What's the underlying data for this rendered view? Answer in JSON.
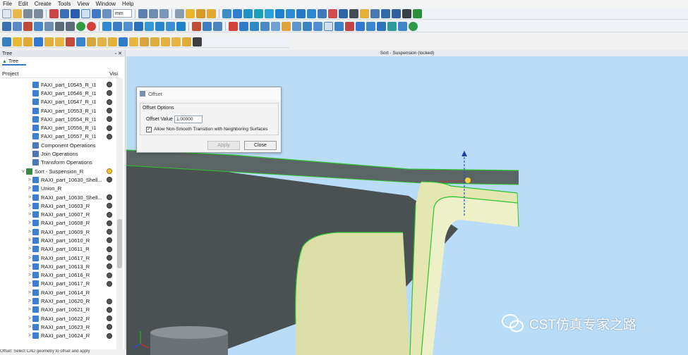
{
  "menu": [
    "File",
    "Edit",
    "Create",
    "Tools",
    "View",
    "Window",
    "Help"
  ],
  "toolbar": {
    "units_value": "mm"
  },
  "tree": {
    "panel_title": "Tree",
    "tab_label": "Tree",
    "col_project": "Project",
    "col_visible": "Visi",
    "items": [
      {
        "label": "FAXI_part_10545_R_I1",
        "indent": 1,
        "chev": "",
        "icon": "part-icon",
        "vis": true
      },
      {
        "label": "FAXI_part_10546_R_I1",
        "indent": 1,
        "chev": "",
        "icon": "part-icon",
        "vis": true
      },
      {
        "label": "FAXI_part_10547_R_I1",
        "indent": 1,
        "chev": "",
        "icon": "part-icon",
        "vis": true
      },
      {
        "label": "FAXI_part_10553_R_I1",
        "indent": 1,
        "chev": "",
        "icon": "part-icon",
        "vis": true
      },
      {
        "label": "FAXI_part_10554_R_I1",
        "indent": 1,
        "chev": "",
        "icon": "part-icon",
        "vis": true
      },
      {
        "label": "FAXI_part_10556_R_I1",
        "indent": 1,
        "chev": "",
        "icon": "part-icon",
        "vis": true
      },
      {
        "label": "FAXI_part_10557_R_I1",
        "indent": 1,
        "chev": "",
        "icon": "part-icon",
        "vis": true
      },
      {
        "label": "Component Operations",
        "indent": 1,
        "chev": "",
        "icon": "operations-icon",
        "vis": false
      },
      {
        "label": "Join Operations",
        "indent": 1,
        "chev": "",
        "icon": "operations-icon",
        "vis": false
      },
      {
        "label": "Transform Operations",
        "indent": 1,
        "chev": "",
        "icon": "operations-icon",
        "vis": false
      },
      {
        "label": "Sort - Suspension_R",
        "indent": 0,
        "chev": "v",
        "icon": "sort-icon",
        "vis": false
      },
      {
        "label": "RAXI_part_10630_Shell...",
        "indent": 1,
        "chev": ">",
        "icon": "part-icon",
        "vis": true
      },
      {
        "label": "Union_R",
        "indent": 1,
        "chev": ">",
        "icon": "part-icon",
        "vis": false
      },
      {
        "label": "RAXI_part_10630_Shell...",
        "indent": 1,
        "chev": ">",
        "icon": "part-icon",
        "vis": true
      },
      {
        "label": "RAXI_part_10603_R",
        "indent": 1,
        "chev": ">",
        "icon": "part-icon",
        "vis": true
      },
      {
        "label": "RAXI_part_10607_R",
        "indent": 1,
        "chev": ">",
        "icon": "part-icon",
        "vis": true
      },
      {
        "label": "RAXI_part_10608_R",
        "indent": 1,
        "chev": ">",
        "icon": "part-icon",
        "vis": true
      },
      {
        "label": "RAXI_part_10609_R",
        "indent": 1,
        "chev": ">",
        "icon": "part-icon",
        "vis": true
      },
      {
        "label": "RAXI_part_10610_R",
        "indent": 1,
        "chev": ">",
        "icon": "part-icon",
        "vis": true
      },
      {
        "label": "RAXI_part_10611_R",
        "indent": 1,
        "chev": ">",
        "icon": "part-icon",
        "vis": true
      },
      {
        "label": "RAXI_part_10617_R",
        "indent": 1,
        "chev": ">",
        "icon": "part-icon",
        "vis": true
      },
      {
        "label": "RAXI_part_10613_R",
        "indent": 1,
        "chev": ">",
        "icon": "part-icon",
        "vis": true
      },
      {
        "label": "RAXI_part_10616_R",
        "indent": 1,
        "chev": ">",
        "icon": "part-icon",
        "vis": true
      },
      {
        "label": "RAXI_part_10617_R",
        "indent": 1,
        "chev": ">",
        "icon": "part-icon",
        "vis": true
      },
      {
        "label": "RAXI_part_10614_R",
        "indent": 1,
        "chev": ">",
        "icon": "part-icon",
        "vis": false
      },
      {
        "label": "RAXI_part_10620_R",
        "indent": 1,
        "chev": ">",
        "icon": "part-icon",
        "vis": true
      },
      {
        "label": "RAXI_part_10621_R",
        "indent": 1,
        "chev": ">",
        "icon": "part-icon",
        "vis": true
      },
      {
        "label": "RAXI_part_10622_R",
        "indent": 1,
        "chev": ">",
        "icon": "part-icon",
        "vis": true
      },
      {
        "label": "RAXI_part_10623_R",
        "indent": 1,
        "chev": ">",
        "icon": "part-icon",
        "vis": true
      },
      {
        "label": "RAXI_part_10624_R",
        "indent": 1,
        "chev": ">",
        "icon": "part-icon",
        "vis": true
      }
    ]
  },
  "viewport": {
    "title": "Sort - Suspension (locked)"
  },
  "dialog": {
    "title": "Offset",
    "group_title": "Offset Options",
    "value_label": "Offset Value",
    "value": "1.00000",
    "checkbox_label": "Allow Non-Smooth Transition with Neighboring Surfaces",
    "checkbox_checked": true,
    "apply_label": "Apply",
    "close_label": "Close"
  },
  "status": {
    "text": "Offset: Select CAD geometry to offset and apply"
  },
  "watermark": {
    "text": "CST仿真专家之路"
  },
  "colors": {
    "viewport_bg": "#b9dcf8",
    "part_dark": "#4a5152",
    "part_light": "#e4e7b2",
    "edge_green": "#2fc42f"
  }
}
